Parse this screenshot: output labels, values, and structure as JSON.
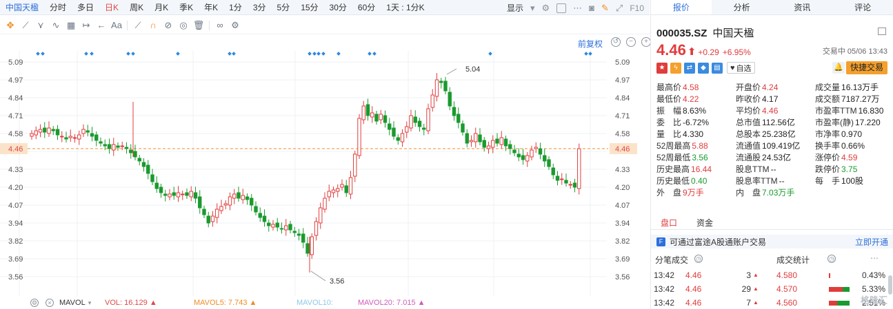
{
  "periods": {
    "stock_name": "中国天楹",
    "items": [
      "分时",
      "多日",
      "日K",
      "周K",
      "月K",
      "季K",
      "年K",
      "1分",
      "3分",
      "5分",
      "15分",
      "30分",
      "60分",
      "1天 : 1分K"
    ],
    "display_label": "显示",
    "f10_label": "F10"
  },
  "chart": {
    "fq_label": "前复权",
    "price_ticks": [
      "5.09",
      "4.97",
      "4.84",
      "4.71",
      "4.58",
      "4.46",
      "4.33",
      "4.20",
      "4.07",
      "3.94",
      "3.82",
      "3.69",
      "3.56"
    ],
    "current_line_label": "4.46",
    "high_annotation": "5.04",
    "low_annotation": "3.56",
    "colors": {
      "up": "#e03c3c",
      "down": "#1a9a2e",
      "grid": "#eef1f4",
      "current_line": "#f08b24",
      "marker": "#2d8ae0"
    }
  },
  "indicators": {
    "name": "MAVOL",
    "vol": "VOL: 16.129",
    "ma5": "MAVOL5: 7.743",
    "ma10": "MAVOL10:",
    "ma20": "MAVOL20: 7.015"
  },
  "quote": {
    "tabs": [
      "报价",
      "分析",
      "资讯",
      "评论"
    ],
    "code": "000035.SZ",
    "name": "中国天楹",
    "price": "4.46",
    "change": "+0.29",
    "change_pct": "+6.95%",
    "trade_status": "交易中 05/06 13:43",
    "favorite_label": "自选",
    "quick_trade_label": "快捷交易",
    "stats": [
      [
        {
          "k": "最高价",
          "v": "4.58",
          "c": "red"
        },
        {
          "k": "开盘价",
          "v": "4.24",
          "c": "red"
        },
        {
          "k": "成交量",
          "v": "16.13万手",
          "c": "dark"
        }
      ],
      [
        {
          "k": "最低价",
          "v": "4.22",
          "c": "red"
        },
        {
          "k": "昨收价",
          "v": "4.17",
          "c": "dark"
        },
        {
          "k": "成交额",
          "v": "7187.27万",
          "c": "dark"
        }
      ],
      [
        {
          "k": "振　幅",
          "v": "8.63%",
          "c": "dark"
        },
        {
          "k": "平均价",
          "v": "4.46",
          "c": "red"
        },
        {
          "k": "市盈率TTM",
          "v": "16.830",
          "c": "dark"
        }
      ],
      [
        {
          "k": "委　比",
          "v": "-6.72%",
          "c": "dark"
        },
        {
          "k": "总市值",
          "v": "112.56亿",
          "c": "dark"
        },
        {
          "k": "市盈率(静)",
          "v": "17.220",
          "c": "dark"
        }
      ],
      [
        {
          "k": "量　比",
          "v": "4.330",
          "c": "dark"
        },
        {
          "k": "总股本",
          "v": "25.238亿",
          "c": "dark"
        },
        {
          "k": "市净率",
          "v": "0.970",
          "c": "dark"
        }
      ],
      [
        {
          "k": "52周最高",
          "v": "5.88",
          "c": "red"
        },
        {
          "k": "流通值",
          "v": "109.419亿",
          "c": "dark"
        },
        {
          "k": "换手率",
          "v": "0.66%",
          "c": "dark"
        }
      ],
      [
        {
          "k": "52周最低",
          "v": "3.56",
          "c": "green"
        },
        {
          "k": "流通股",
          "v": "24.53亿",
          "c": "dark"
        },
        {
          "k": "涨停价",
          "v": "4.59",
          "c": "red"
        }
      ],
      [
        {
          "k": "历史最高",
          "v": "16.44",
          "c": "red"
        },
        {
          "k": "股息TTM",
          "v": "--",
          "c": "dark"
        },
        {
          "k": "跌停价",
          "v": "3.75",
          "c": "green"
        }
      ],
      [
        {
          "k": "历史最低",
          "v": "0.40",
          "c": "green"
        },
        {
          "k": "股息率TTM",
          "v": "--",
          "c": "dark"
        },
        {
          "k": "每　手",
          "v": "100股",
          "c": "dark"
        }
      ],
      [
        {
          "k": "外　盘",
          "v": "9万手",
          "c": "red"
        },
        {
          "k": "内　盘",
          "v": "7.03万手",
          "c": "green"
        },
        {
          "k": "",
          "v": "",
          "c": "dark"
        }
      ]
    ],
    "section_tabs": [
      "盘口",
      "资金"
    ],
    "futu_text": "可通过富途A股通账户交易",
    "futu_link": "立即开通",
    "split_title": "分笔成交",
    "stat_title": "成交统计",
    "trades": [
      {
        "time": "13:42",
        "price": "4.46",
        "vol": "3",
        "sprice": "4.580",
        "pct": "0.43%",
        "bar_red": 0.04,
        "bar_green": 0
      },
      {
        "time": "13:42",
        "price": "4.46",
        "vol": "29",
        "sprice": "4.570",
        "pct": "5.33%",
        "bar_red": 0.66,
        "bar_green": 0.34
      },
      {
        "time": "13:42",
        "price": "4.46",
        "vol": "7",
        "sprice": "4.560",
        "pct": "2.51%",
        "bar_red": 0.4,
        "bar_green": 0.6
      }
    ],
    "watermark": "格隆汇"
  }
}
